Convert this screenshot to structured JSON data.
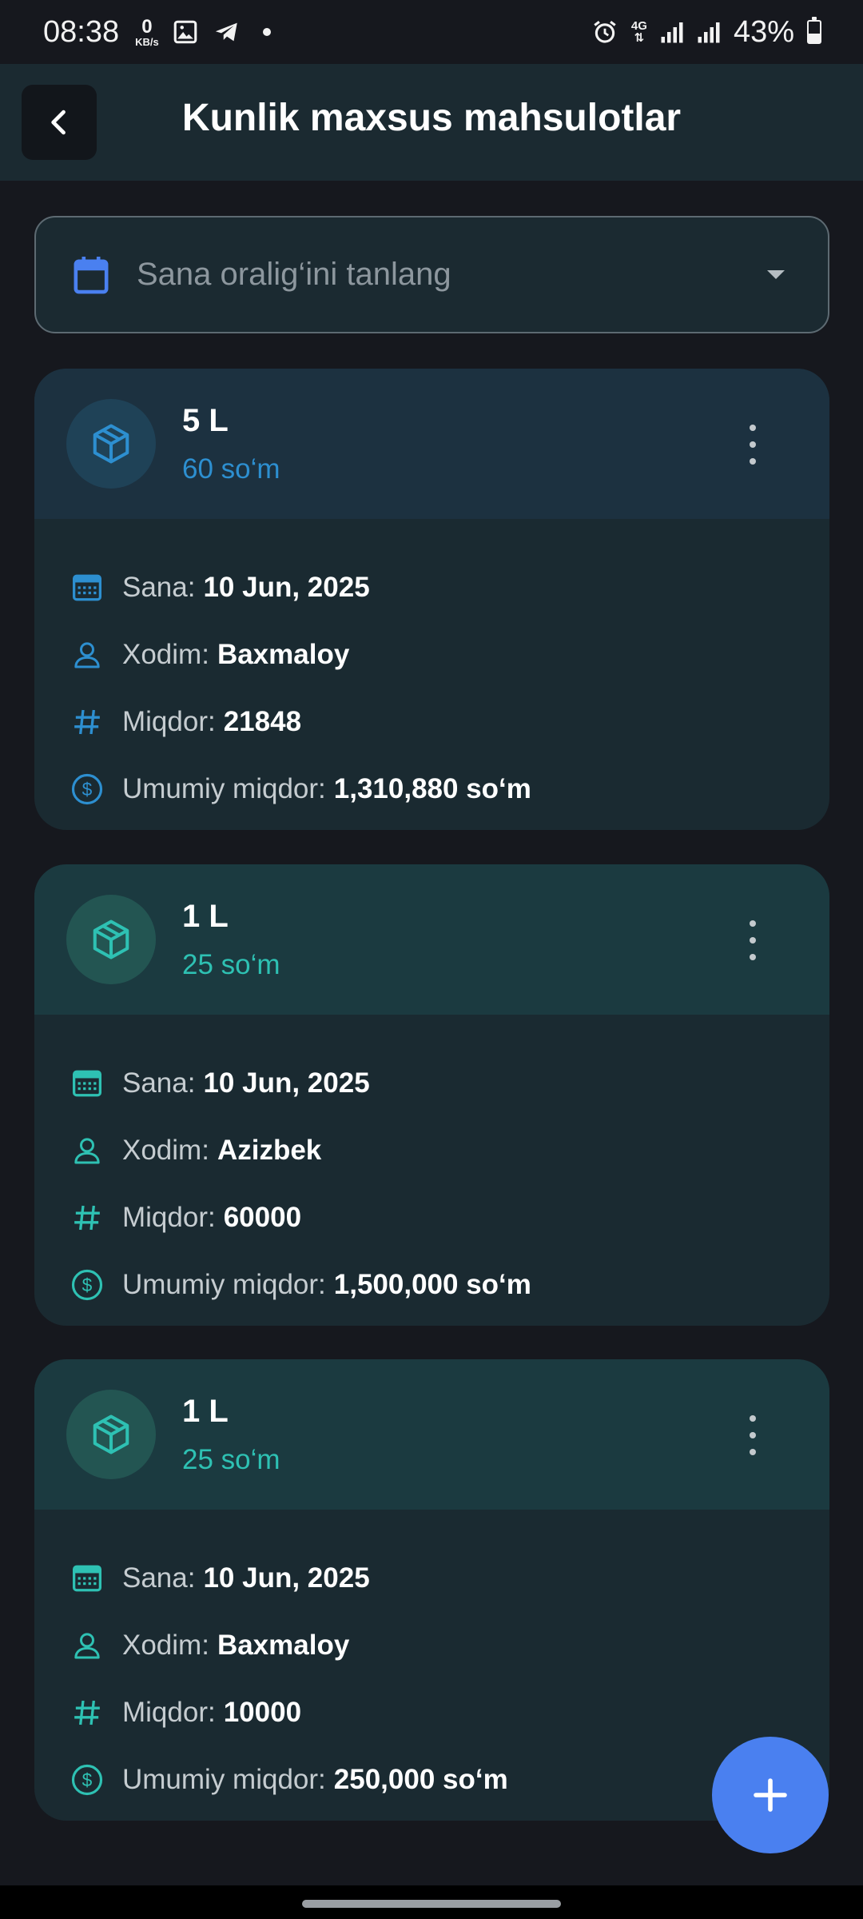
{
  "status_bar": {
    "time": "08:38",
    "net_speed_value": "0",
    "net_speed_unit": "KB/s",
    "network": "4G",
    "battery": "43%",
    "battery_level": 0.43
  },
  "header": {
    "title": "Kunlik maxsus mahsulotlar"
  },
  "date_filter": {
    "placeholder": "Sana oralig‘ini tanlang"
  },
  "labels": {
    "date": "Sana:",
    "employee": "Xodim:",
    "quantity": "Miqdor:",
    "total": "Umumiy miqdor:"
  },
  "colors": {
    "blue_accent": "#2d8fd0",
    "teal_accent": "#2ec1b3",
    "fab": "#4a80f0"
  },
  "items": [
    {
      "name": "5 L",
      "price": "60 so‘m",
      "date": "10 Jun, 2025",
      "employee": "Baxmaloy",
      "quantity": "21848",
      "total": "1,310,880 so‘m"
    },
    {
      "name": "1 L",
      "price": "25 so‘m",
      "date": "10 Jun, 2025",
      "employee": "Azizbek",
      "quantity": "60000",
      "total": "1,500,000 so‘m"
    },
    {
      "name": "1 L",
      "price": "25 so‘m",
      "date": "10 Jun, 2025",
      "employee": "Baxmaloy",
      "quantity": "10000",
      "total": "250,000 so‘m"
    }
  ]
}
